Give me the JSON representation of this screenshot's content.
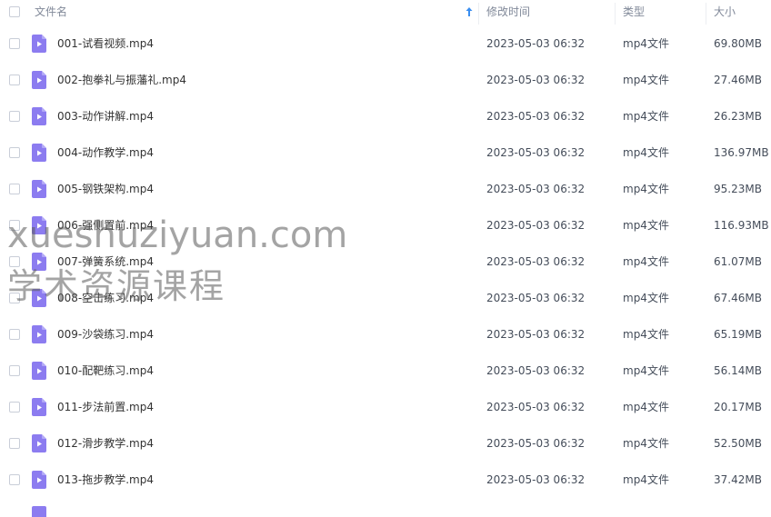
{
  "header": {
    "name_label": "文件名",
    "modified_label": "修改时间",
    "type_label": "类型",
    "size_label": "大小"
  },
  "files": [
    {
      "name": "001-试看视频.mp4",
      "modified": "2023-05-03 06:32",
      "type": "mp4文件",
      "size": "69.80MB"
    },
    {
      "name": "002-抱拳礼与振藩礼.mp4",
      "modified": "2023-05-03 06:32",
      "type": "mp4文件",
      "size": "27.46MB"
    },
    {
      "name": "003-动作讲解.mp4",
      "modified": "2023-05-03 06:32",
      "type": "mp4文件",
      "size": "26.23MB"
    },
    {
      "name": "004-动作教学.mp4",
      "modified": "2023-05-03 06:32",
      "type": "mp4文件",
      "size": "136.97MB"
    },
    {
      "name": "005-钢铁架构.mp4",
      "modified": "2023-05-03 06:32",
      "type": "mp4文件",
      "size": "95.23MB"
    },
    {
      "name": "006-强侧置前.mp4",
      "modified": "2023-05-03 06:32",
      "type": "mp4文件",
      "size": "116.93MB"
    },
    {
      "name": "007-弹簧系统.mp4",
      "modified": "2023-05-03 06:32",
      "type": "mp4文件",
      "size": "61.07MB"
    },
    {
      "name": "008-空击练习.mp4",
      "modified": "2023-05-03 06:32",
      "type": "mp4文件",
      "size": "67.46MB"
    },
    {
      "name": "009-沙袋练习.mp4",
      "modified": "2023-05-03 06:32",
      "type": "mp4文件",
      "size": "65.19MB"
    },
    {
      "name": "010-配靶练习.mp4",
      "modified": "2023-05-03 06:32",
      "type": "mp4文件",
      "size": "56.14MB"
    },
    {
      "name": "011-步法前置.mp4",
      "modified": "2023-05-03 06:32",
      "type": "mp4文件",
      "size": "20.17MB"
    },
    {
      "name": "012-滑步教学.mp4",
      "modified": "2023-05-03 06:32",
      "type": "mp4文件",
      "size": "52.50MB"
    },
    {
      "name": "013-拖步教学.mp4",
      "modified": "2023-05-03 06:32",
      "type": "mp4文件",
      "size": "37.42MB"
    }
  ],
  "watermark": {
    "line1": "xueshuziyuan.com",
    "line2": "学术资源课程"
  },
  "colors": {
    "icon_purple": "#8c7cf0",
    "sort_arrow": "#3a8ef0",
    "header_text": "#818999"
  },
  "icons": {
    "file": "video-file-icon",
    "sort": "sort-ascending-arrow-icon"
  }
}
